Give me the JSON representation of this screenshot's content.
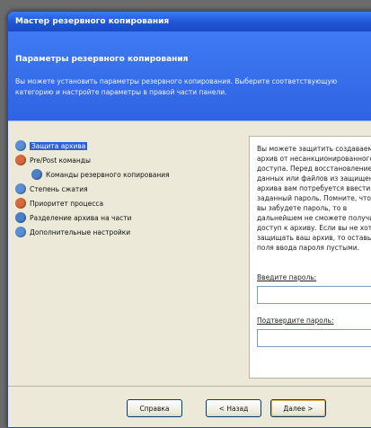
{
  "window": {
    "title": "Мастер резервного копирования"
  },
  "banner": {
    "heading": "Параметры резервного копирования",
    "description": "Вы можете установить параметры резервного копирования. Выберите соответствующую категорию и настройте параметры в правой части панели."
  },
  "tree": {
    "items": [
      {
        "label": "Защита архива",
        "icon": "shield-icon",
        "color": "#5a8fd8",
        "selected": true
      },
      {
        "label": "Pre/Post команды",
        "icon": "command-icon",
        "color": "#d86a3a",
        "selected": false
      },
      {
        "label": "Команды резервного копирования",
        "icon": "backup-command-icon",
        "color": "#4a7fc9",
        "selected": false
      },
      {
        "label": "Степень сжатия",
        "icon": "compression-icon",
        "color": "#5a8fd8",
        "selected": false
      },
      {
        "label": "Приоритет процесса",
        "icon": "priority-icon",
        "color": "#d86a3a",
        "selected": false
      },
      {
        "label": "Разделение архива на части",
        "icon": "split-icon",
        "color": "#4a7fc9",
        "selected": false
      },
      {
        "label": "Дополнительные настройки",
        "icon": "advanced-settings-icon",
        "color": "#5a8fd8",
        "selected": false
      }
    ]
  },
  "help": {
    "text": "Вы можете защитить создаваемый архив от несанкционированного доступа. Перед восстановлением данных или файлов из защищенного архива вам потребуется ввести заданный пароль. Помните, что если вы забудете пароль, то в дальнейшем не сможете получить доступ к архиву. Если вы не хотите защищать ваш архив, то оставьте поля ввода пароля пустыми.",
    "password_label": "Введите пароль:",
    "confirm_label": "Подтвердите пароль:",
    "password_value": "",
    "confirm_value": ""
  },
  "footer": {
    "help_label": "Справка",
    "back_label": "< Назад",
    "next_label": "Далее >"
  },
  "colors": {
    "accent": "#2f63e3",
    "selection": "#2e5ed6"
  }
}
